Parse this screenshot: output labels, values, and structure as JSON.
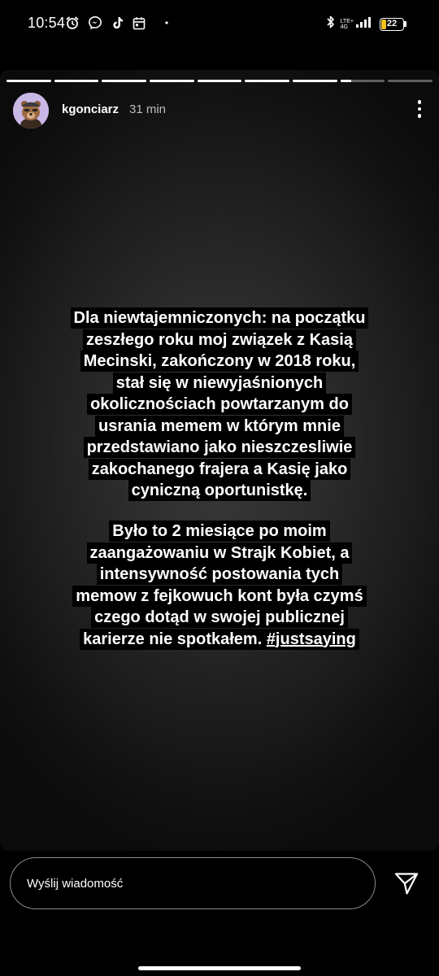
{
  "status_bar": {
    "time": "10:54",
    "left_icons": [
      "alarm-icon",
      "messenger-icon",
      "tiktok-icon",
      "calendar-icon",
      "dot-icon"
    ],
    "right_icons": [
      "bluetooth-icon",
      "lte-signal-icon",
      "battery-icon"
    ],
    "lte_label_top": "LTE+",
    "lte_label_bottom": "4G",
    "battery_level": "22",
    "battery_color": "#f2c11a"
  },
  "story": {
    "segment_count": 9,
    "segments_viewed": 7,
    "current_segment_progress": 0.25,
    "username": "kgonciarz",
    "time_ago": "31 min",
    "avatar_icon": "bear-avatar-icon",
    "more_icon": "more-vertical-icon",
    "paragraph1": [
      "Dla niewtajemniczonych: na początku",
      "zeszłego roku moj związek z Kasią",
      "Mecinski, zakończony w 2018 roku,",
      "stał się w niewyjaśnionych",
      "okolicznościach powtarzanym do",
      "usrania memem w którym mnie",
      "przedstawiano jako nieszczesliwie",
      "zakochanego frajera a Kasię jako",
      "cyniczną oportunistkę."
    ],
    "paragraph2": [
      "Było to 2 miesiące po moim",
      "zaangażowaniu w Strajk Kobiet, a",
      "intensywność postowania tych",
      "memow z fejkowuch kont była czymś",
      "czego dotąd w swojej publicznej"
    ],
    "paragraph2_last_line_text": "karierze nie spotkałem. ",
    "hashtag": "#justsaying"
  },
  "reply": {
    "placeholder": "Wyślij wiadomość",
    "send_icon": "send-icon"
  }
}
